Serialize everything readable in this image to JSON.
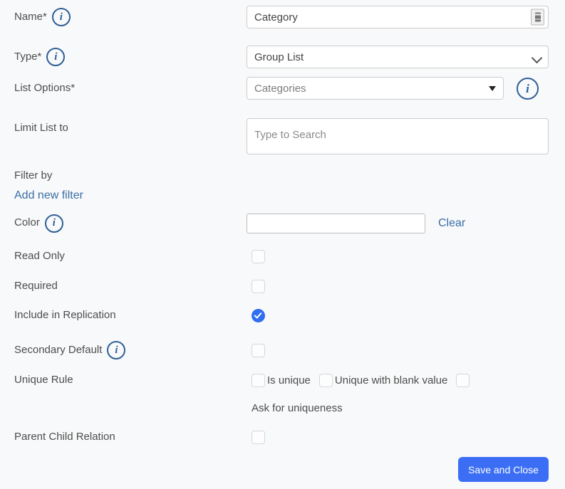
{
  "theme": {
    "background": "#f8f9fa",
    "accent_blue": "#3b6ef5",
    "link_blue": "#3a6ea8",
    "info_icon_blue": "#2f6096",
    "label_gray": "#4d4d4d"
  },
  "fields": {
    "name": {
      "label": "Name*",
      "value": "Category",
      "info_icon": "info-icon",
      "inline_icon": "translation-badge-icon"
    },
    "type": {
      "label": "Type*",
      "value": "Group List",
      "options": [
        "Group List"
      ],
      "info_icon": "info-icon",
      "chevron": "chevron-down-icon"
    },
    "list_options": {
      "label": "List Options*",
      "value": "Categories",
      "caret": "caret-down-icon",
      "info_icon": "info-icon"
    },
    "limit_list_to": {
      "label": "Limit List to",
      "value": "",
      "placeholder": "Type to Search"
    },
    "filter_by": {
      "label": "Filter by",
      "add_link": "Add new filter"
    },
    "color": {
      "label": "Color",
      "value": "",
      "clear_label": "Clear",
      "info_icon": "info-icon"
    },
    "read_only": {
      "label": "Read Only",
      "checked": false
    },
    "required": {
      "label": "Required",
      "checked": false
    },
    "include_in_replication": {
      "label": "Include in Replication",
      "checked": true
    },
    "secondary_default": {
      "label": "Secondary Default",
      "checked": false,
      "info_icon": "info-icon"
    },
    "unique_rule": {
      "label": "Unique Rule",
      "is_unique_label": "Is unique",
      "is_unique_checked": false,
      "unique_blank_label": "Unique with blank value",
      "unique_blank_checked": false,
      "third_checked": false,
      "ask_label": "Ask for uniqueness"
    },
    "parent_child_relation": {
      "label": "Parent Child Relation",
      "checked": false
    }
  },
  "footer": {
    "save_label": "Save and Close"
  }
}
